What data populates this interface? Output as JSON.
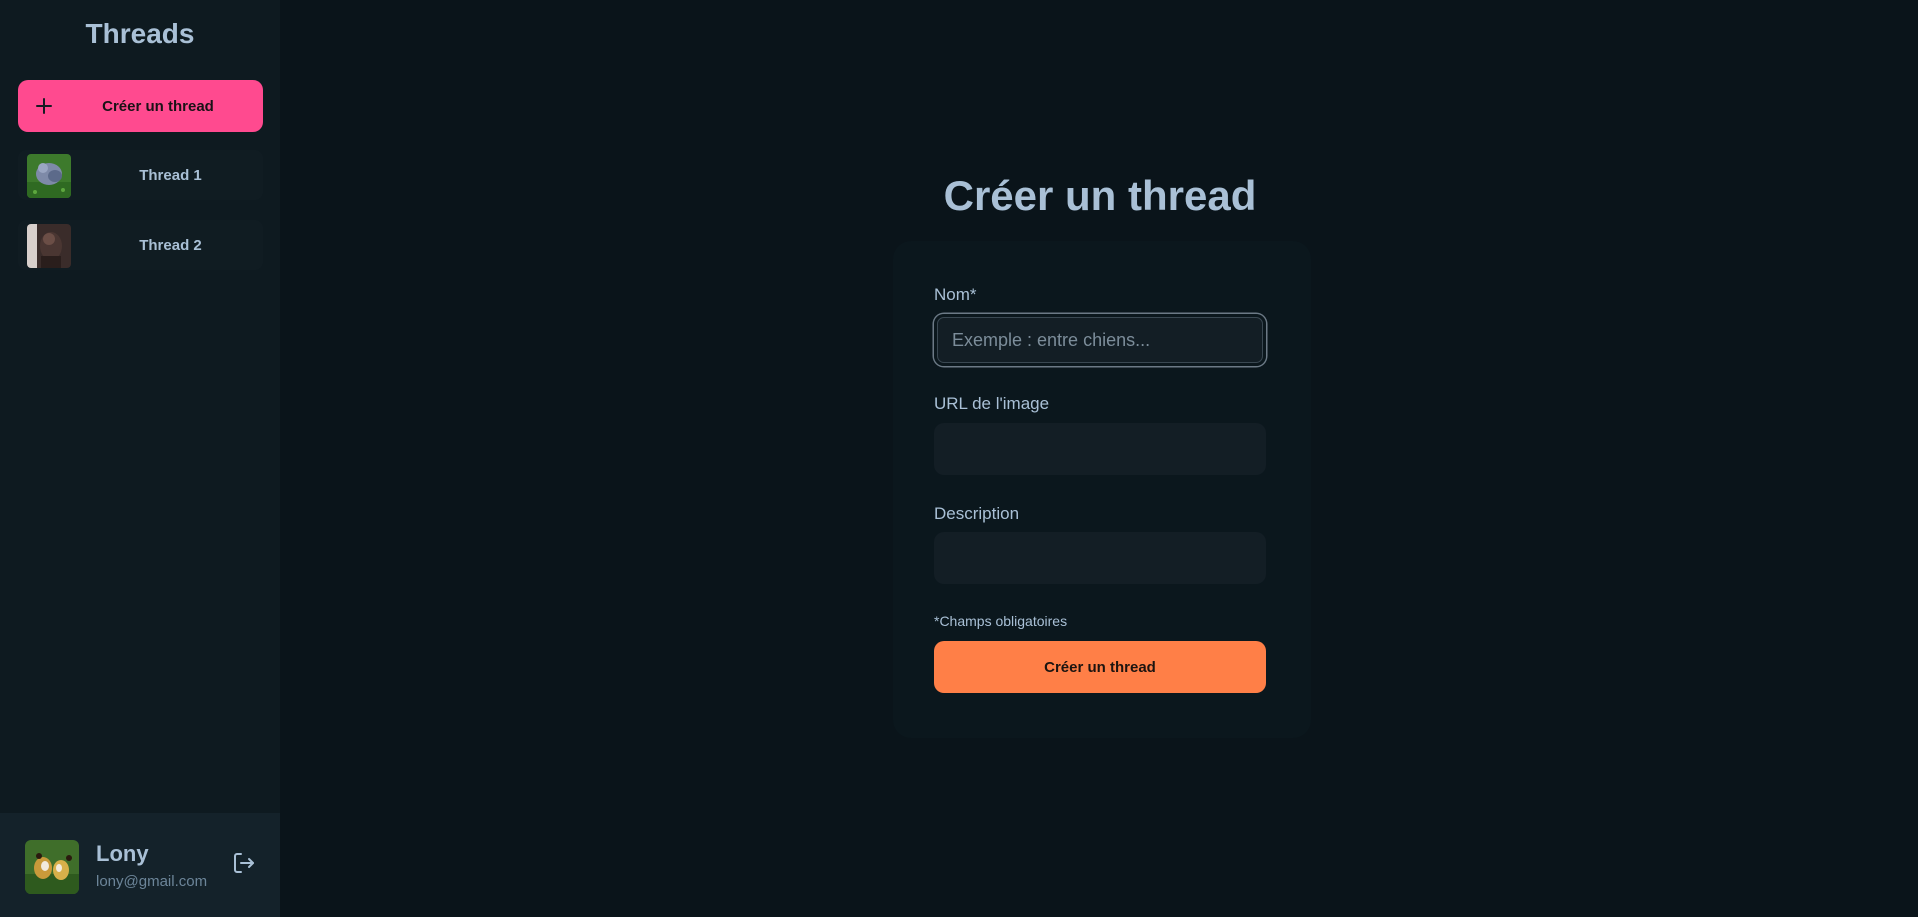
{
  "sidebar": {
    "title": "Threads",
    "create_button_label": "Créer un thread",
    "threads": [
      {
        "name": "Thread 1"
      },
      {
        "name": "Thread 2"
      }
    ]
  },
  "user": {
    "name": "Lony",
    "email": "lony@gmail.com"
  },
  "form": {
    "title": "Créer un thread",
    "name_label": "Nom*",
    "name_placeholder": "Exemple : entre chiens...",
    "image_url_label": "URL de l'image",
    "description_label": "Description",
    "required_note": "*Champs obligatoires",
    "submit_label": "Créer un thread"
  },
  "colors": {
    "background": "#0a141a",
    "sidebar": "#0e1a20",
    "create_button": "#ff4a8f",
    "submit_button": "#ff7f47",
    "text": "#a9c0d6"
  },
  "icons": {
    "create": "plus-icon",
    "logout": "logout-icon"
  }
}
